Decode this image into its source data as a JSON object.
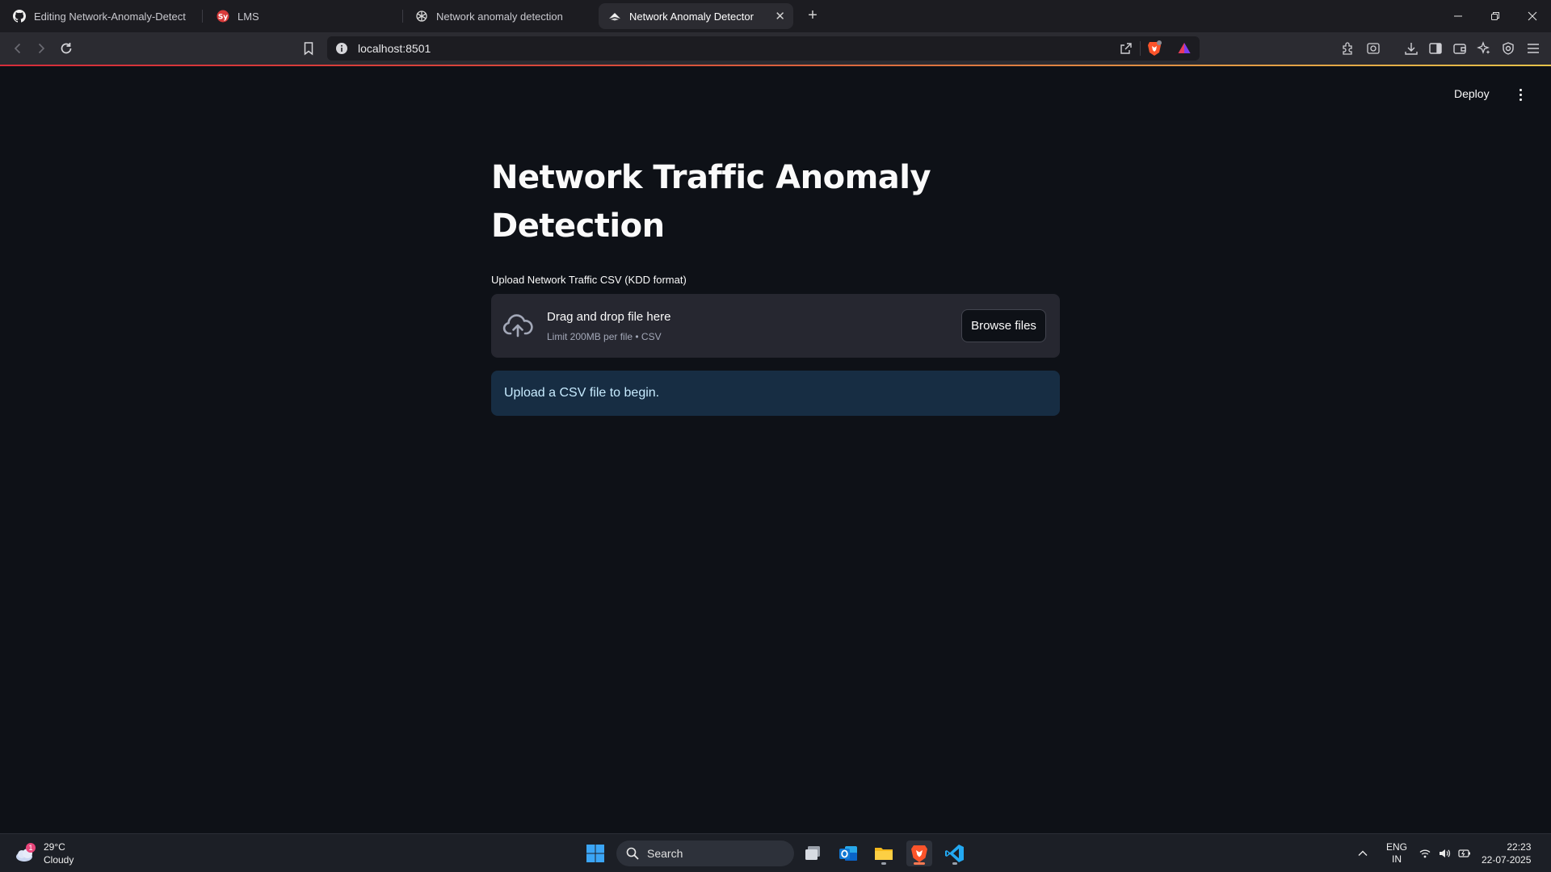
{
  "browser": {
    "tabs": [
      {
        "title": "Editing Network-Anomaly-Detector/R",
        "icon": "github-icon"
      },
      {
        "title": "LMS",
        "icon": "lms-icon"
      },
      {
        "title": "Network anomaly detection",
        "icon": "chatgpt-icon"
      },
      {
        "title": "Network Anomaly Detector",
        "icon": "streamlit-icon",
        "active": true
      }
    ],
    "url": "localhost:8501"
  },
  "app": {
    "deploy_label": "Deploy",
    "title": "Network Traffic Anomaly Detection",
    "uploader": {
      "label": "Upload Network Traffic CSV (KDD format)",
      "drop_title": "Drag and drop file here",
      "drop_subtitle": "Limit 200MB per file • CSV",
      "browse_label": "Browse files"
    },
    "info_message": "Upload a CSV file to begin."
  },
  "taskbar": {
    "weather": {
      "temp": "29°C",
      "condition": "Cloudy",
      "badge": "1"
    },
    "search_placeholder": "Search",
    "lang": {
      "line1": "ENG",
      "line2": "IN"
    },
    "clock": {
      "time": "22:23",
      "date": "22-07-2025"
    }
  },
  "colors": {
    "background": "#0e1117",
    "dropzone": "#262730",
    "info_bg": "#172d43",
    "info_text": "#c7ebff"
  }
}
